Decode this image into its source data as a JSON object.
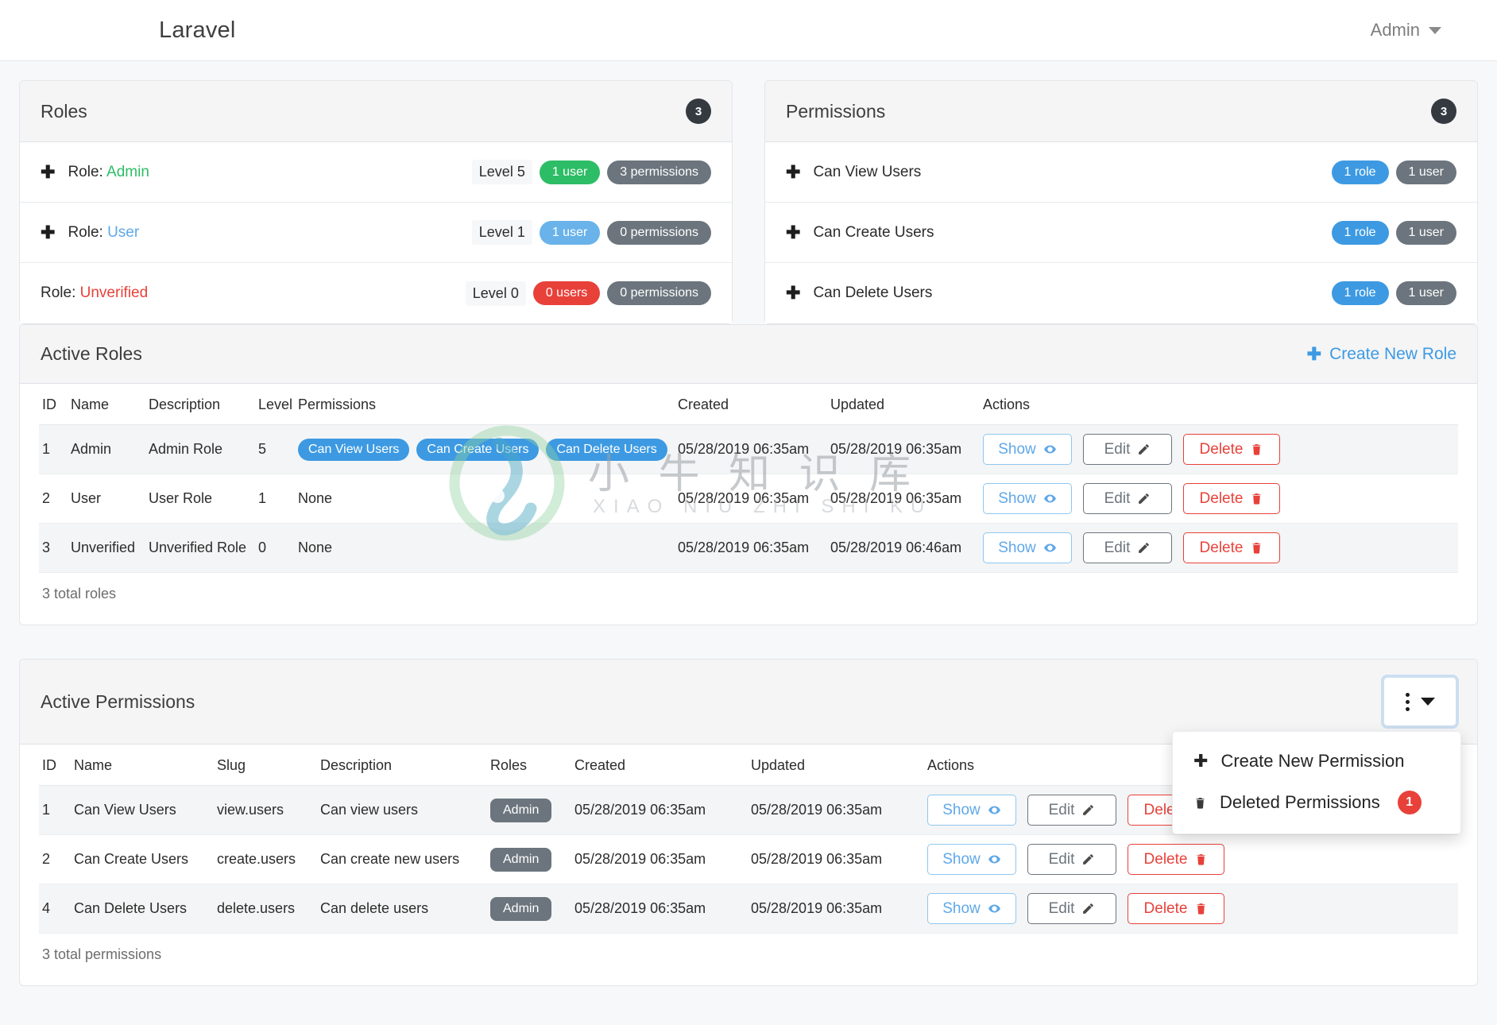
{
  "navbar": {
    "brand": "Laravel",
    "user_menu": "Admin"
  },
  "roles_panel": {
    "title": "Roles",
    "count": "3",
    "items": [
      {
        "prefix": "Role:",
        "name": "Admin",
        "level": "Level 5",
        "users": "1 user",
        "permissions": "3 permissions",
        "expandable": true
      },
      {
        "prefix": "Role:",
        "name": "User",
        "level": "Level 1",
        "users": "1 user",
        "permissions": "0 permissions",
        "expandable": true
      },
      {
        "prefix": "Role:",
        "name": "Unverified",
        "level": "Level 0",
        "users": "0 users",
        "permissions": "0 permissions",
        "expandable": false
      }
    ]
  },
  "permissions_panel": {
    "title": "Permissions",
    "count": "3",
    "items": [
      {
        "name": "Can View Users",
        "roles": "1 role",
        "users": "1 user"
      },
      {
        "name": "Can Create Users",
        "roles": "1 role",
        "users": "1 user"
      },
      {
        "name": "Can Delete Users",
        "roles": "1 role",
        "users": "1 user"
      }
    ]
  },
  "active_roles": {
    "title": "Active Roles",
    "create_link": "Create New Role",
    "columns": [
      "ID",
      "Name",
      "Description",
      "Level",
      "Permissions",
      "Created",
      "Updated",
      "Actions"
    ],
    "rows": [
      {
        "id": "1",
        "name": "Admin",
        "description": "Admin Role",
        "level": "5",
        "permissions": [
          "Can View Users",
          "Can Create Users",
          "Can Delete Users"
        ],
        "permissions_none": "",
        "created": "05/28/2019 06:35am",
        "updated": "05/28/2019 06:35am",
        "show": "Show",
        "edit": "Edit",
        "delete": "Delete"
      },
      {
        "id": "2",
        "name": "User",
        "description": "User Role",
        "level": "1",
        "permissions": [],
        "permissions_none": "None",
        "created": "05/28/2019 06:35am",
        "updated": "05/28/2019 06:35am",
        "show": "Show",
        "edit": "Edit",
        "delete": "Delete"
      },
      {
        "id": "3",
        "name": "Unverified",
        "description": "Unverified Role",
        "level": "0",
        "permissions": [],
        "permissions_none": "None",
        "created": "05/28/2019 06:35am",
        "updated": "05/28/2019 06:46am",
        "show": "Show",
        "edit": "Edit",
        "delete": "Delete"
      }
    ],
    "footer": "3 total roles"
  },
  "active_permissions": {
    "title": "Active Permissions",
    "menu": {
      "create": "Create New Permission",
      "deleted": "Deleted Permissions",
      "deleted_count": "1"
    },
    "columns": [
      "ID",
      "Name",
      "Slug",
      "Description",
      "Roles",
      "Created",
      "Updated",
      "Actions"
    ],
    "rows": [
      {
        "id": "1",
        "name": "Can View Users",
        "slug": "view.users",
        "description": "Can view users",
        "role": "Admin",
        "created": "05/28/2019 06:35am",
        "updated": "05/28/2019 06:35am",
        "show": "Show",
        "edit": "Edit",
        "delete": "Delete"
      },
      {
        "id": "2",
        "name": "Can Create Users",
        "slug": "create.users",
        "description": "Can create new users",
        "role": "Admin",
        "created": "05/28/2019 06:35am",
        "updated": "05/28/2019 06:35am",
        "show": "Show",
        "edit": "Edit",
        "delete": "Delete"
      },
      {
        "id": "4",
        "name": "Can Delete Users",
        "slug": "delete.users",
        "description": "Can delete users",
        "role": "Admin",
        "created": "05/28/2019 06:35am",
        "updated": "05/28/2019 06:35am",
        "show": "Show",
        "edit": "Edit",
        "delete": "Delete"
      }
    ],
    "footer": "3 total permissions"
  },
  "watermark": {
    "text": "小 牛 知 识 库",
    "subtext": "XIAO NIU ZHI SHI KU"
  },
  "colors": {
    "accent_blue": "#3d9ae2",
    "green": "#2dbd66",
    "red": "#e8413a",
    "gray": "#6c757d",
    "dark": "#343a40"
  }
}
